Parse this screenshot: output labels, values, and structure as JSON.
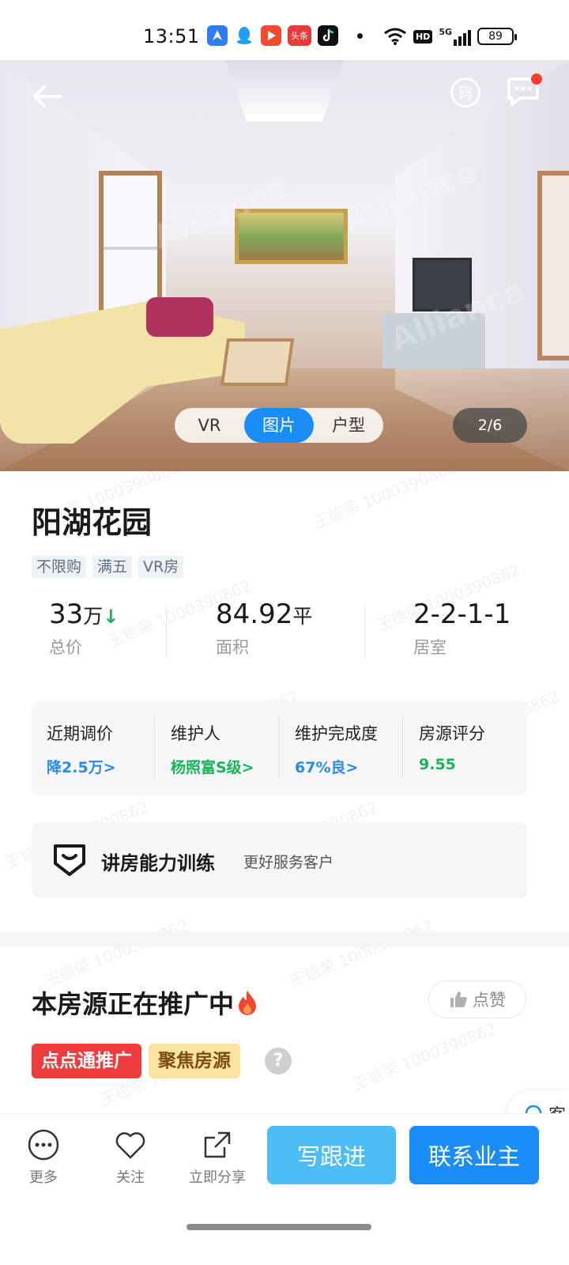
{
  "status_bar": {
    "time": "13:51",
    "battery": "89",
    "apps": [
      "maps-app-icon",
      "qq-icon",
      "video-app-icon",
      "toutiao-icon",
      "tiktok-icon"
    ],
    "toutiao_label": "头条",
    "network_hd": "HD",
    "network_5g": "5G"
  },
  "hero": {
    "qr_label": "码",
    "tabs": [
      "VR",
      "图片",
      "户型"
    ],
    "active_tab": "图片",
    "counter": "2/6",
    "watermark_text": "Alliance"
  },
  "watermark": "王德荣 1000390862",
  "property": {
    "name": "阳湖花园",
    "tags": [
      "不限购",
      "满五",
      "VR房"
    ],
    "total_price": "33",
    "total_price_unit": "万",
    "total_price_label": "总价",
    "area": "84.92",
    "area_unit": "平",
    "area_label": "面积",
    "layout": "2-2-1-1",
    "layout_label": "居室"
  },
  "metrics": [
    {
      "label": "近期调价",
      "value": "降2.5万>",
      "color": "#2a8ae6"
    },
    {
      "label": "维护人",
      "value": "杨照富S级>",
      "color": "#19b35b"
    },
    {
      "label": "维护完成度",
      "value": "67%良>",
      "color": "#2a8ae6"
    },
    {
      "label": "房源评分",
      "value": "9.55",
      "color": "#19b35b"
    }
  ],
  "training": {
    "title": "讲房能力训练",
    "subtitle": "更好服务客户"
  },
  "promotion": {
    "title": "本房源正在推广中",
    "like_label": "点赞",
    "tags": [
      "点点通推广",
      "聚焦房源"
    ],
    "help": "?"
  },
  "float_service": {
    "label": "客"
  },
  "bottom_bar": {
    "more": "更多",
    "follow": "关注",
    "share": "立即分享",
    "write_followup": "写跟进",
    "contact_owner": "联系业主"
  },
  "colors": {
    "primary": "#1a8cf5",
    "secondary_button": "#4dbdf6",
    "green": "#19b35b",
    "promo_red": "#ee3b3b",
    "promo_yellow": "#fbe3a2"
  }
}
